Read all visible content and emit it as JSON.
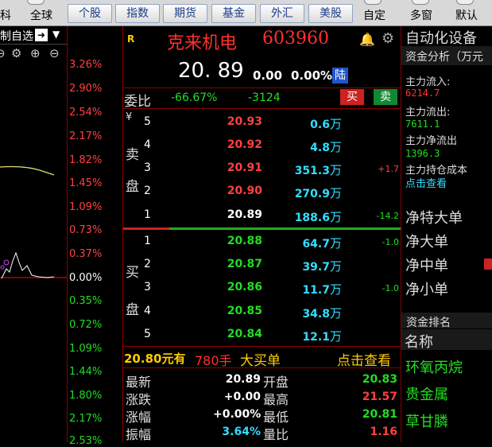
{
  "toolbar": {
    "left_cut": "科",
    "global": "全球",
    "buttons": [
      "个股",
      "指数",
      "期货",
      "基金",
      "外汇",
      "美股"
    ],
    "zixuan": "自定",
    "multi": "多窗",
    "default": "默认"
  },
  "chart": {
    "header_label": "制自选",
    "pct_labels": [
      {
        "t": "3.26%",
        "c": "red"
      },
      {
        "t": "2.90%",
        "c": "red"
      },
      {
        "t": "2.54%",
        "c": "red"
      },
      {
        "t": "2.17%",
        "c": "red"
      },
      {
        "t": "1.82%",
        "c": "red"
      },
      {
        "t": "1.45%",
        "c": "red"
      },
      {
        "t": "1.09%",
        "c": "red"
      },
      {
        "t": "0.73%",
        "c": "red"
      },
      {
        "t": "0.37%",
        "c": "red"
      },
      {
        "t": "0.00%",
        "c": "wht"
      },
      {
        "t": "0.35%",
        "c": "grn"
      },
      {
        "t": "0.72%",
        "c": "grn"
      },
      {
        "t": "1.09%",
        "c": "grn"
      },
      {
        "t": "1.44%",
        "c": "grn"
      },
      {
        "t": "1.80%",
        "c": "grn"
      },
      {
        "t": "2.17%",
        "c": "grn"
      },
      {
        "t": "2.53%",
        "c": "grn"
      }
    ]
  },
  "stock": {
    "r_badge": "R",
    "name": "克来机电",
    "code": "603960",
    "price": "20. 89",
    "change": "0.00",
    "change_pct": "0.00%",
    "market": "陆"
  },
  "weibi": {
    "label": "委比",
    "ratio": "-66.67%",
    "diff": "-3124",
    "buy": "买",
    "sell": "卖"
  },
  "sell_label": {
    "yen": "¥",
    "a": "卖",
    "b": "盘"
  },
  "buy_label": {
    "a": "买",
    "b": "盘"
  },
  "sell_rows": [
    {
      "n": "5",
      "price": "20.93",
      "vol": "0.6",
      "chg": ""
    },
    {
      "n": "4",
      "price": "20.92",
      "vol": "4.8",
      "chg": ""
    },
    {
      "n": "3",
      "price": "20.91",
      "vol": "351.3",
      "chg": "+1.7"
    },
    {
      "n": "2",
      "price": "20.90",
      "vol": "270.9",
      "chg": ""
    },
    {
      "n": "1",
      "price": "20.89",
      "vol": "188.6",
      "chg": "-14.2"
    }
  ],
  "buy_rows": [
    {
      "n": "1",
      "price": "20.88",
      "vol": "64.7",
      "chg": "-1.0"
    },
    {
      "n": "2",
      "price": "20.87",
      "vol": "39.7",
      "chg": ""
    },
    {
      "n": "3",
      "price": "20.86",
      "vol": "11.7",
      "chg": "-1.0"
    },
    {
      "n": "4",
      "price": "20.85",
      "vol": "34.8",
      "chg": ""
    },
    {
      "n": "5",
      "price": "20.84",
      "vol": "12.1",
      "chg": ""
    }
  ],
  "wan": "万",
  "big_order": {
    "price_text": "20.80元有",
    "qty": "780手",
    "desc": "大买单",
    "link": "点击查看"
  },
  "quote": {
    "latest_l": "最新",
    "latest_v": "20.89",
    "open_l": "开盘",
    "open_v": "20.83",
    "chg_l": "涨跌",
    "chg_v": "+0.00",
    "high_l": "最高",
    "high_v": "21.57",
    "pct_l": "涨幅",
    "pct_v": "+0.00%",
    "low_l": "最低",
    "low_v": "20.81",
    "amp_l": "振幅",
    "amp_v": "3.64%",
    "vr_l": "量比",
    "vr_v": "1.16"
  },
  "right": {
    "sector": "自动化设备",
    "fund_title": "资金分析（万元",
    "inflow_l": "主力流入:",
    "inflow_v": "6214.7",
    "outflow_l": "主力流出:",
    "outflow_v": "7611.1",
    "net_l": "主力净流出",
    "net_v": "1396.3",
    "hold_l": "主力持仓成本",
    "hold_link": "点击查看",
    "nets": [
      "净特大单",
      "净大单",
      "净中单",
      "净小单"
    ],
    "rank_title": "资金排名",
    "name_col": "名称",
    "names": [
      "环氧丙烷",
      "贵金属",
      "草甘膦"
    ]
  },
  "colors": {
    "up": "#ff4040",
    "down": "#22dd22",
    "accent": "#ffcc00",
    "vol": "#33ddff"
  }
}
